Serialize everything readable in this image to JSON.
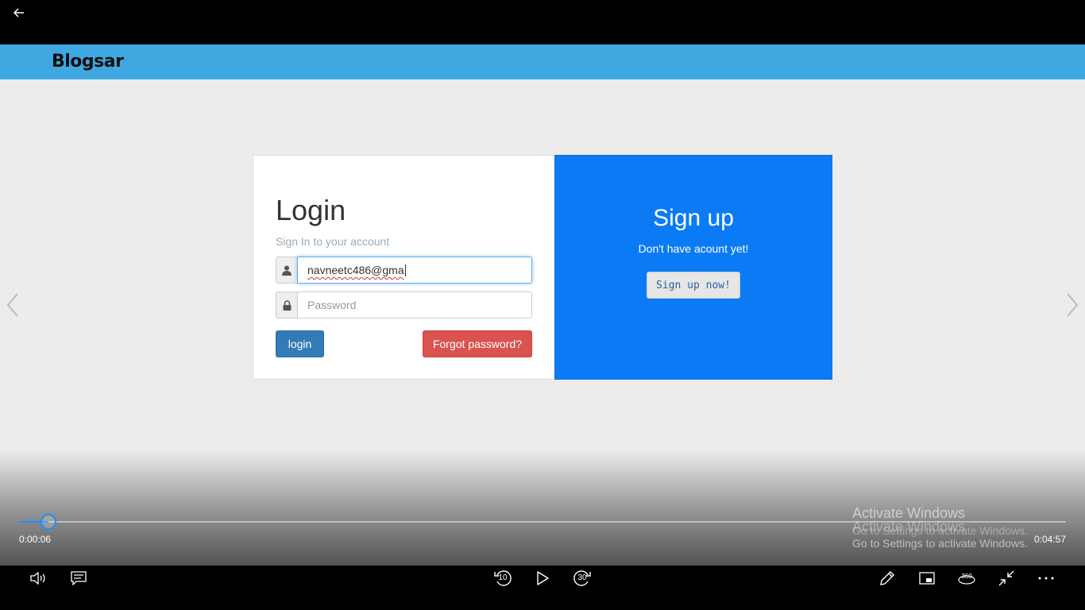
{
  "site": {
    "brand": "Blogsar"
  },
  "login": {
    "title": "Login",
    "subtitle": "Sign In to your account",
    "email_value": "navneetc486@gma",
    "password_placeholder": "Password",
    "login_label": "login",
    "forgot_label": "Forgot password?"
  },
  "signup": {
    "title": "Sign up",
    "subtitle": "Don't have acount yet!",
    "button_label": "Sign up now!"
  },
  "player": {
    "current_time": "0:00:06",
    "total_time": "0:04:57",
    "progress_fraction": 0.028,
    "skip_back": "10",
    "skip_forward": "30",
    "three_sixty": "360",
    "accent_color": "#1e90ff"
  },
  "watermark": {
    "line1": "Activate Windows",
    "line2": "Activate Windows",
    "line3": "Go to Settings to activate Windows.",
    "line4": "Go to Settings to activate Windows."
  },
  "colors": {
    "header": "#40a8e0",
    "signup_panel": "#0a7bf5",
    "login_button": "#337ab7",
    "forgot_button": "#d9534f"
  },
  "icons": [
    "back-arrow-icon",
    "user-icon",
    "lock-icon",
    "chevron-left-icon",
    "chevron-right-icon",
    "volume-icon",
    "captions-icon",
    "skip-back-icon",
    "play-icon",
    "skip-forward-icon",
    "pen-icon",
    "mini-view-icon",
    "360-icon",
    "exit-fullscreen-icon",
    "more-icon"
  ]
}
